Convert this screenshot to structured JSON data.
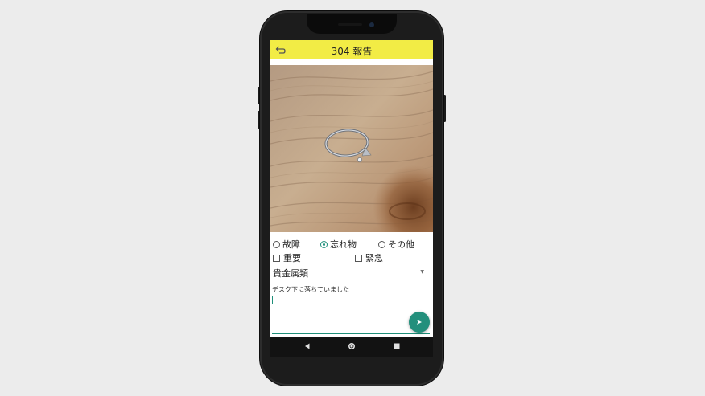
{
  "appbar": {
    "title": "304 報告",
    "color": "#f2ec45",
    "back_icon": "back-arrow-icon"
  },
  "photo": {
    "subject": "silver ring on wooden table"
  },
  "category": {
    "options": [
      {
        "label": "故障",
        "selected": false
      },
      {
        "label": "忘れ物",
        "selected": true
      },
      {
        "label": "その他",
        "selected": false
      }
    ]
  },
  "flags": {
    "options": [
      {
        "label": "重要",
        "checked": false
      },
      {
        "label": "緊急",
        "checked": false
      }
    ]
  },
  "item_type": {
    "selected": "貴金属類"
  },
  "memo": {
    "text": "デスク下に落ちていました"
  },
  "fab": {
    "icon": "send-icon",
    "color": "#238f7c"
  },
  "navbar": {
    "icons": [
      "back-triangle-icon",
      "home-circle-icon",
      "recents-square-icon"
    ]
  }
}
